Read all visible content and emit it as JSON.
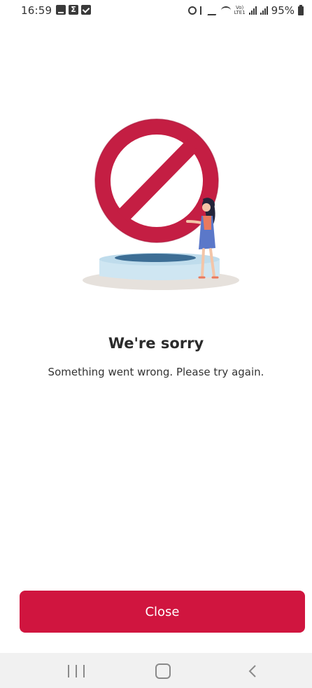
{
  "status_bar": {
    "time": "16:59",
    "battery": "95%",
    "left_icons": [
      "gallery-icon",
      "sigma-icon",
      "check-icon"
    ],
    "right_icons": [
      "alarm-icon",
      "bluetooth-icon",
      "mute-icon",
      "wifi-icon",
      "volte-icon",
      "signal-icon",
      "signal-icon",
      "battery-icon"
    ],
    "volte_label_top": "Vo)",
    "volte_label_bottom": "LTE1"
  },
  "error": {
    "title": "We're sorry",
    "message": "Something went wrong. Please try again."
  },
  "actions": {
    "close_label": "Close"
  },
  "nav_bar": {
    "icons": [
      "recents-icon",
      "home-icon",
      "back-icon"
    ]
  },
  "colors": {
    "accent": "#d0153f",
    "background": "#ffffff",
    "nav_background": "#f1f1f1"
  }
}
